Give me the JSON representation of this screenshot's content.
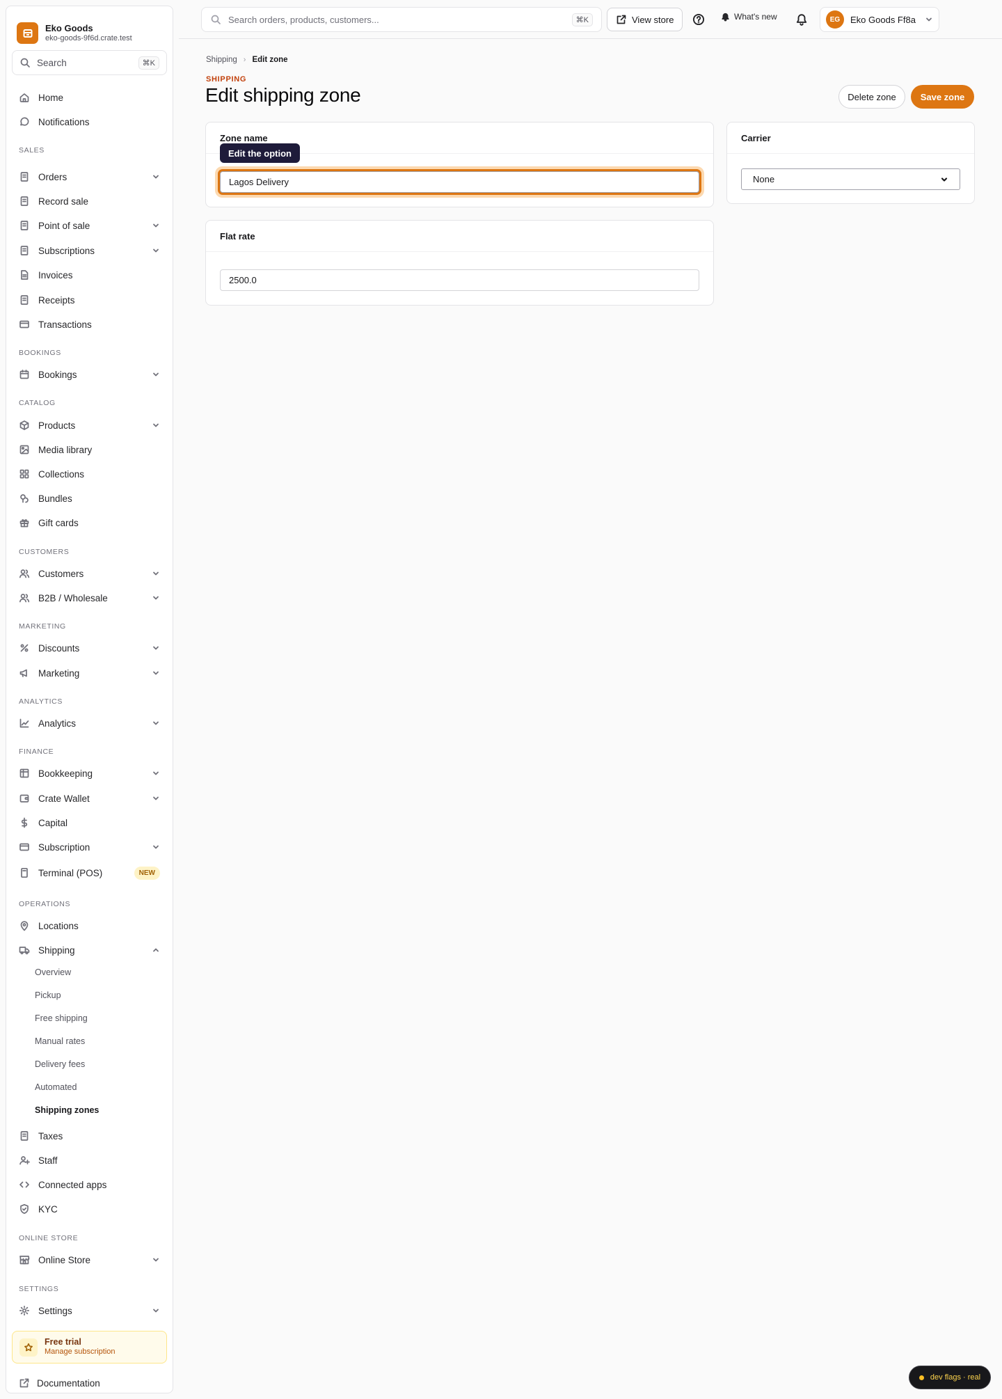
{
  "sidebar": {
    "brand_name": "Eko Goods",
    "brand_domain": "eko-goods-9f6d.crate.test",
    "search_placeholder": "Search",
    "search_shortcut": "⌘K",
    "top_items": [
      {
        "label": "Home",
        "icon": "home-icon"
      },
      {
        "label": "Notifications",
        "icon": "chat-bubble-icon"
      }
    ],
    "sections": {
      "sales": "SALES",
      "bookings": "BOOKINGS",
      "catalog": "CATALOG",
      "customers": "CUSTOMERS",
      "marketing": "MARKETING",
      "analytics": "ANALYTICS",
      "finance": "FINANCE",
      "operations": "OPERATIONS",
      "online_store": "ONLINE STORE",
      "settings": "SETTINGS"
    },
    "sales_items": [
      "Orders",
      "Record sale",
      "Point of sale",
      "Subscriptions",
      "Invoices",
      "Receipts",
      "Transactions"
    ],
    "bookings_items": [
      "Bookings"
    ],
    "catalog_items": [
      "Products",
      "Media library",
      "Collections",
      "Bundles",
      "Gift cards"
    ],
    "customers_items": [
      "Customers",
      "B2B / Wholesale"
    ],
    "marketing_items": [
      "Discounts",
      "Marketing"
    ],
    "analytics_items": [
      "Analytics"
    ],
    "finance_items": [
      "Bookkeeping",
      "Crate Wallet",
      "Capital",
      "Subscription",
      "Terminal (POS)"
    ],
    "new_badge": "NEW",
    "operations_items": [
      "Locations",
      "Shipping"
    ],
    "shipping_sub": [
      "Overview",
      "Pickup",
      "Free shipping",
      "Manual rates",
      "Delivery fees",
      "Automated",
      "Shipping zones"
    ],
    "more_items": [
      "Taxes",
      "Staff",
      "Connected apps",
      "KYC"
    ],
    "online_store_items": [
      "Online Store"
    ],
    "settings_items": [
      "Settings"
    ],
    "trial_title": "Free trial",
    "trial_sub": "Manage subscription",
    "documentation": "Documentation"
  },
  "topbar": {
    "search_placeholder": "Search orders, products, customers...",
    "search_shortcut": "⌘K",
    "view_store": "View store",
    "whats_new": "What's new",
    "avatar_initials": "EG",
    "account_name": "Eko Goods Ff8a"
  },
  "main": {
    "breadcrumb": [
      "Shipping",
      "Edit zone"
    ],
    "eyebrow": "SHIPPING",
    "title": "Edit shipping zone",
    "delete_button": "Delete zone",
    "save_button": "Save zone",
    "zone_card": {
      "title": "Zone name",
      "value": "Lagos Delivery",
      "tooltip": "Edit the option"
    },
    "carrier_card": {
      "title": "Carrier",
      "selected": "None"
    },
    "rate_card": {
      "title": "Flat rate",
      "value": "2500.0"
    }
  },
  "dev_flags": "dev flags · real",
  "colors": {
    "accent": "#dd7612",
    "tooltip_bg": "#1e1b3a"
  }
}
